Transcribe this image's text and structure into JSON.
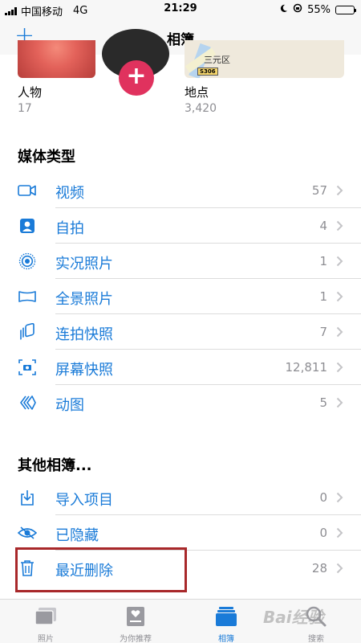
{
  "status_bar": {
    "carrier": "中国移动",
    "network": "4G",
    "time": "21:29",
    "battery": "55%",
    "battery_level": 0.55
  },
  "nav": {
    "title": "相簿",
    "add_icon": "plus-icon"
  },
  "top_albums": [
    {
      "name": "人物",
      "count": "17"
    },
    {
      "name": "地点",
      "count": "3,420",
      "map_label": "三元区",
      "map_badge": "S306"
    }
  ],
  "media_types": {
    "title": "媒体类型",
    "rows": [
      {
        "label": "视频",
        "count": "57",
        "icon": "video-camera-icon"
      },
      {
        "label": "自拍",
        "count": "4",
        "icon": "portrait-icon"
      },
      {
        "label": "实况照片",
        "count": "1",
        "icon": "live-photo-icon"
      },
      {
        "label": "全景照片",
        "count": "1",
        "icon": "panorama-icon"
      },
      {
        "label": "连拍快照",
        "count": "7",
        "icon": "burst-icon"
      },
      {
        "label": "屏幕快照",
        "count": "12,811",
        "icon": "screenshot-icon"
      },
      {
        "label": "动图",
        "count": "5",
        "icon": "animated-icon"
      }
    ]
  },
  "other_albums": {
    "title": "其他相簿...",
    "rows": [
      {
        "label": "导入项目",
        "count": "0",
        "icon": "import-icon"
      },
      {
        "label": "已隐藏",
        "count": "0",
        "icon": "hidden-eye-icon"
      },
      {
        "label": "最近删除",
        "count": "28",
        "icon": "trash-icon"
      }
    ]
  },
  "tabs": [
    {
      "label": "照片",
      "icon": "photos-tab-icon"
    },
    {
      "label": "为你推荐",
      "icon": "for-you-tab-icon"
    },
    {
      "label": "相簿",
      "icon": "albums-tab-icon",
      "active": true
    },
    {
      "label": "搜索",
      "icon": "search-tab-icon"
    }
  ],
  "watermark": "Bai经验",
  "colors": {
    "accent": "#1a7bd8",
    "highlight_border": "#a8282a",
    "secondary_text": "#8e8e93"
  }
}
